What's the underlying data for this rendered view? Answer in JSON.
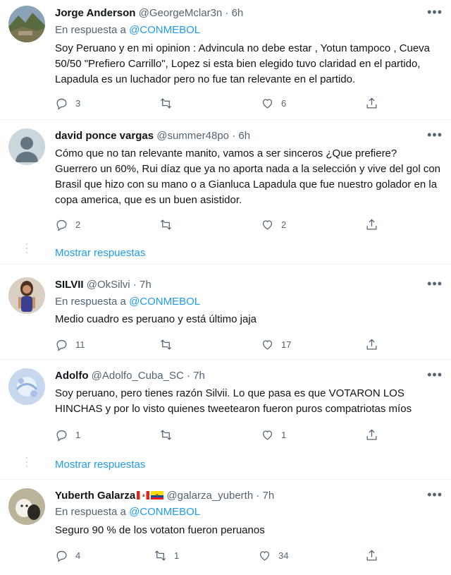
{
  "tweets": [
    {
      "name": "Jorge Anderson",
      "handle": "@GeorgeMclar3n",
      "time": "6h",
      "reply_prefix": "En respuesta a",
      "reply_to": "@CONMEBOL",
      "text": "Soy Peruano y en mi opinion : Advincula no debe estar , Yotun tampoco , Cueva 50/50 \"Prefiero Carrillo\", Lopez si esta bien elegido tuvo claridad en el partido, Lapadula es un luchador pero no fue tan relevante en el partido.",
      "replies": "3",
      "retweets": "",
      "likes": "6"
    },
    {
      "name": "david ponce vargas",
      "handle": "@summer48po",
      "time": "6h",
      "text": "Cómo que no tan relevante manito, vamos a ser sinceros ¿Que prefiere? Guerrero un 60%, Rui díaz que ya no aporta nada a la selección y vive del gol  con Brasil que hizo con su mano o a Gianluca Lapadula que fue nuestro golador en la copa america, que es un buen asistidor.",
      "replies": "2",
      "retweets": "",
      "likes": "2",
      "show_more": "Mostrar respuestas"
    },
    {
      "name": "SILVII",
      "handle": "@OkSilvi",
      "time": "7h",
      "reply_prefix": "En respuesta a",
      "reply_to": "@CONMEBOL",
      "text": "Medio cuadro es peruano y está último jaja",
      "replies": "11",
      "retweets": "",
      "likes": "17"
    },
    {
      "name": "Adolfo",
      "handle": "@Adolfo_Cuba_SC",
      "time": "7h",
      "text": "Soy peruano, pero tienes razón Silvii. Lo que pasa es que VOTARON LOS HINCHAS y por lo visto quienes tweetearon fueron puros compatriotas míos",
      "replies": "1",
      "retweets": "",
      "likes": "1",
      "show_more": "Mostrar respuestas"
    },
    {
      "name": "Yuberth Galarza",
      "handle": "@galarza_yuberth",
      "time": "7h",
      "reply_prefix": "En respuesta a",
      "reply_to": "@CONMEBOL",
      "text": "Seguro 90 % de los votaton fueron peruanos",
      "replies": "4",
      "retweets": "1",
      "likes": "34"
    }
  ],
  "separator": "·",
  "more_glyph": "•••",
  "colors": {
    "link": "#1d9bf0",
    "muted": "#536471",
    "text": "#0f1419",
    "divider": "#eff3f4"
  }
}
